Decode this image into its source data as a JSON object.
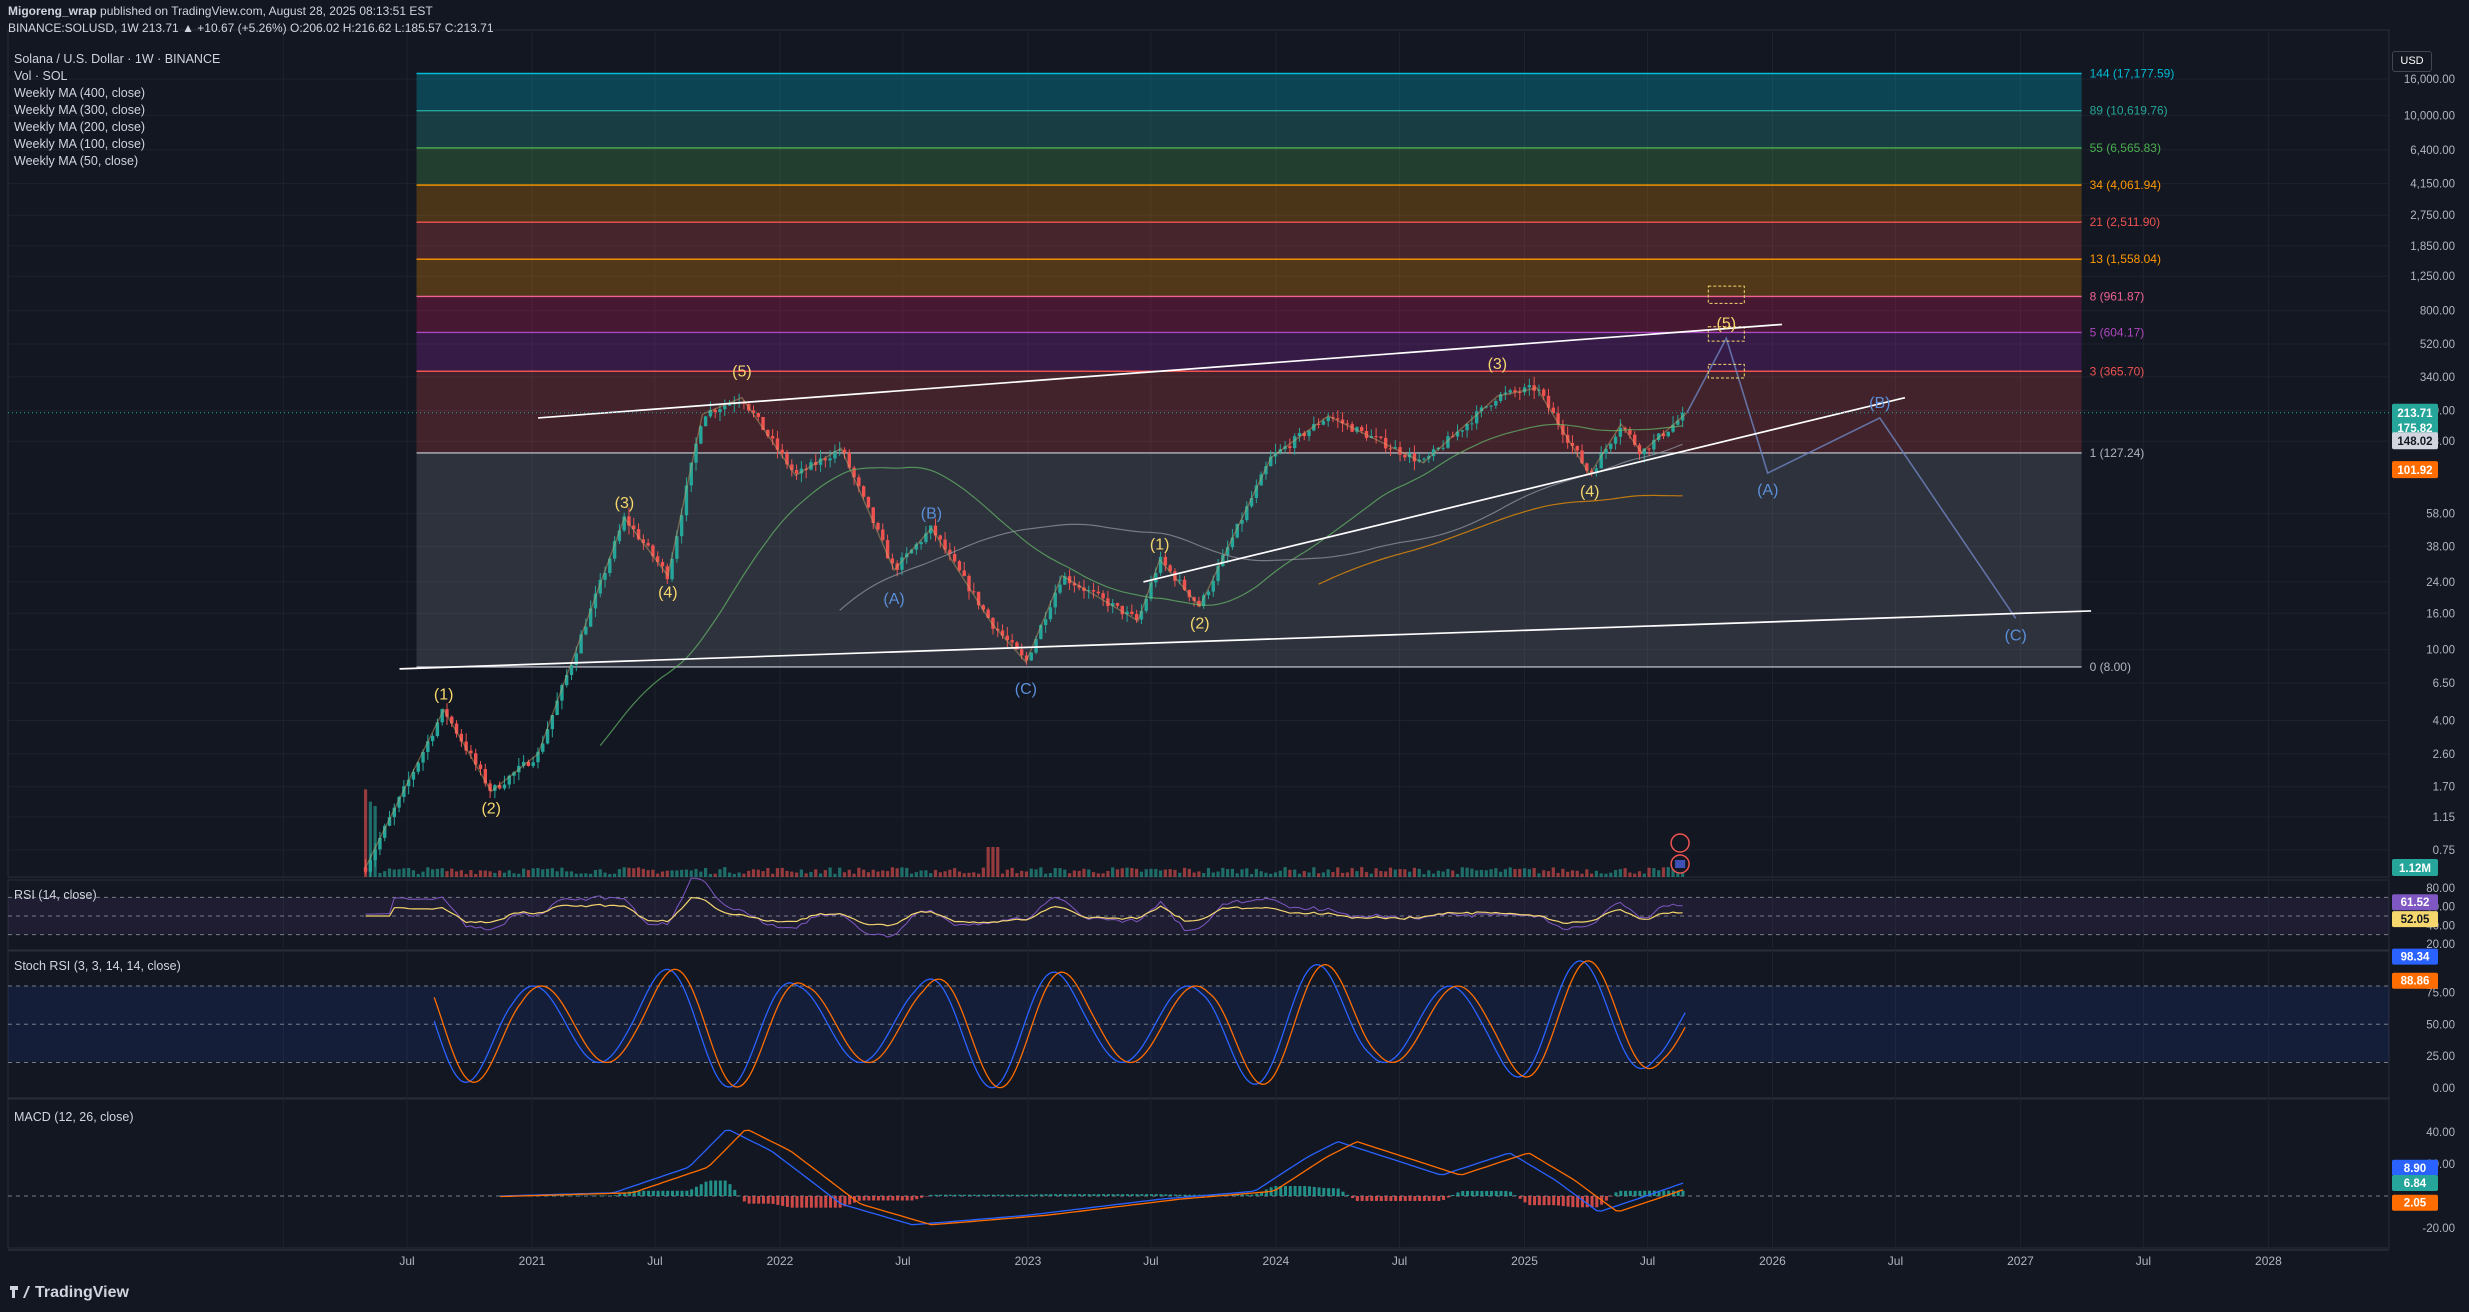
{
  "header": {
    "line1_user": "Migoreng_wrap",
    "line1_rest": " published on TradingView.com, August 28, 2025 08:13:51 EST",
    "line2": "BINANCE:SOLUSD, 1W 213.71 ▲ +10.67 (+5.26%) O:206.02 H:216.62 L:185.57 C:213.71"
  },
  "legend": [
    "Solana / U.S. Dollar · 1W · BINANCE",
    "Vol · SOL",
    "Weekly MA (400, close)",
    "Weekly MA (300, close)",
    "Weekly MA (200, close)",
    "Weekly MA (100, close)",
    "Weekly MA (50, close)"
  ],
  "currency": "USD",
  "brand": "TradingView",
  "pane_labels": {
    "rsi": "RSI (14, close)",
    "stoch": "Stoch RSI (3, 3, 14, 14, close)",
    "macd": "MACD (12, 26, close)"
  },
  "colors": {
    "background": "#131722",
    "up": "#26a69a",
    "down": "#ef5350",
    "wave_yellow": "#f5d76e",
    "wave_blue": "#5b8fd9",
    "rsi_line": "#7e57c2",
    "rsi_ma": "#f5d76e",
    "stoch_k": "#2962ff",
    "stoch_d": "#ff6d00",
    "macd_line": "#2962ff",
    "signal_line": "#ff6d00"
  },
  "chart_data": [
    {
      "type": "candlestick",
      "title": "Solana / U.S. Dollar · 1W · BINANCE",
      "scale": "log",
      "y_ticks": [
        "16,000.00",
        "10,000.00",
        "6,400.00",
        "4,150.00",
        "2,750.00",
        "1,850.00",
        "1,250.00",
        "800.00",
        "520.00",
        "340.00",
        "220.00",
        "148.00",
        "58.00",
        "38.00",
        "24.00",
        "16.00",
        "10.00",
        "6.50",
        "4.00",
        "2.60",
        "1.70",
        "1.15",
        "0.75"
      ],
      "x_ticks": [
        "Jul",
        "2021",
        "Jul",
        "2022",
        "Jul",
        "2023",
        "Jul",
        "2024",
        "Jul",
        "2025",
        "Jul",
        "2026",
        "Jul",
        "2027",
        "Jul",
        "2028"
      ],
      "price_badges": [
        {
          "text": "213.71",
          "color": "#26a69a"
        },
        {
          "text": "175.82",
          "color": "#26a69a"
        },
        {
          "text": "148.02",
          "color": "#d1d4dc"
        },
        {
          "text": "101.92",
          "color": "#ff6d00"
        },
        {
          "text": "1.12M",
          "color": "#26a69a"
        }
      ],
      "price_path": [
        {
          "d": "2020-05-01",
          "p": 0.6
        },
        {
          "d": "2020-08-24",
          "p": 4.6
        },
        {
          "d": "2020-11-02",
          "p": 1.6
        },
        {
          "d": "2021-01-10",
          "p": 2.6
        },
        {
          "d": "2021-05-17",
          "p": 55
        },
        {
          "d": "2021-07-20",
          "p": 26
        },
        {
          "d": "2021-09-09",
          "p": 210
        },
        {
          "d": "2021-11-06",
          "p": 260
        },
        {
          "d": "2022-01-24",
          "p": 95
        },
        {
          "d": "2022-04-01",
          "p": 135
        },
        {
          "d": "2022-06-18",
          "p": 28
        },
        {
          "d": "2022-08-12",
          "p": 48
        },
        {
          "d": "2022-11-09",
          "p": 14
        },
        {
          "d": "2022-12-29",
          "p": 8.5
        },
        {
          "d": "2023-02-20",
          "p": 26
        },
        {
          "d": "2023-06-12",
          "p": 14.5
        },
        {
          "d": "2023-07-14",
          "p": 32
        },
        {
          "d": "2023-09-11",
          "p": 17.5
        },
        {
          "d": "2023-12-25",
          "p": 120
        },
        {
          "d": "2024-03-18",
          "p": 205
        },
        {
          "d": "2024-08-05",
          "p": 112
        },
        {
          "d": "2024-11-22",
          "p": 265
        },
        {
          "d": "2025-01-19",
          "p": 295
        },
        {
          "d": "2025-04-07",
          "p": 96
        },
        {
          "d": "2025-05-23",
          "p": 185
        },
        {
          "d": "2025-06-22",
          "p": 128
        },
        {
          "d": "2025-08-28",
          "p": 213.71
        }
      ],
      "fib_levels": [
        {
          "label": "144 (17,177.59)",
          "value": 17177.59,
          "color": "#00bcd4",
          "fill": "rgba(0,188,212,0.28)"
        },
        {
          "label": "89 (10,619.76)",
          "value": 10619.76,
          "color": "#26a69a",
          "fill": "rgba(38,166,154,0.28)"
        },
        {
          "label": "55 (6,565.83)",
          "value": 6565.83,
          "color": "#4caf50",
          "fill": "rgba(76,175,80,0.26)"
        },
        {
          "label": "34 (4,061.94)",
          "value": 4061.94,
          "color": "#ff9800",
          "fill": "rgba(255,152,0,0.24)"
        },
        {
          "label": "21 (2,511.90)",
          "value": 2511.9,
          "color": "#ef5350",
          "fill": "rgba(239,83,80,0.24)"
        },
        {
          "label": "13 (1,558.04)",
          "value": 1558.04,
          "color": "#ff9800",
          "fill": "rgba(255,152,0,0.26)"
        },
        {
          "label": "8 (961.87)",
          "value": 961.87,
          "color": "#f06292",
          "fill": "rgba(233,30,99,0.24)"
        },
        {
          "label": "5 (604.17)",
          "value": 604.17,
          "color": "#ab47bc",
          "fill": "rgba(156,39,176,0.26)"
        },
        {
          "label": "3 (365.70)",
          "value": 365.7,
          "color": "#ef5350",
          "fill": "rgba(239,83,80,0.22)"
        },
        {
          "label": "1 (127.24)",
          "value": 127.24,
          "color": "#b2b5be",
          "fill": "rgba(178,181,190,0.12)"
        },
        {
          "label": "0 (8.00)",
          "value": 8.0,
          "color": "#b2b5be",
          "fill": null
        }
      ],
      "wave_labels": [
        {
          "t": "(1)",
          "d": "2020-08-24",
          "p": 4.6,
          "c": "yellow",
          "pos": "above"
        },
        {
          "t": "(2)",
          "d": "2020-11-02",
          "p": 1.6,
          "c": "yellow",
          "pos": "below"
        },
        {
          "t": "(3)",
          "d": "2021-05-17",
          "p": 55,
          "c": "yellow",
          "pos": "above"
        },
        {
          "t": "(4)",
          "d": "2021-07-20",
          "p": 26,
          "c": "yellow",
          "pos": "below"
        },
        {
          "t": "(5)",
          "d": "2021-11-06",
          "p": 300,
          "c": "yellow",
          "pos": "above"
        },
        {
          "t": "(A)",
          "d": "2022-06-18",
          "p": 24,
          "c": "blue",
          "pos": "below"
        },
        {
          "t": "(B)",
          "d": "2022-08-12",
          "p": 48,
          "c": "blue",
          "pos": "above"
        },
        {
          "t": "(C)",
          "d": "2022-12-29",
          "p": 7.5,
          "c": "blue",
          "pos": "below"
        },
        {
          "t": "(1)",
          "d": "2023-07-14",
          "p": 32,
          "c": "yellow",
          "pos": "above"
        },
        {
          "t": "(2)",
          "d": "2023-09-11",
          "p": 17.5,
          "c": "yellow",
          "pos": "below"
        },
        {
          "t": "(3)",
          "d": "2024-11-22",
          "p": 330,
          "c": "yellow",
          "pos": "above"
        },
        {
          "t": "(4)",
          "d": "2025-04-07",
          "p": 96,
          "c": "yellow",
          "pos": "below"
        },
        {
          "t": "(5)",
          "d": "2025-10-25",
          "p": 560,
          "c": "yellow",
          "pos": "above"
        },
        {
          "t": "(A)",
          "d": "2025-12-25",
          "p": 98,
          "c": "blue",
          "pos": "below"
        },
        {
          "t": "(B)",
          "d": "2026-06-08",
          "p": 200,
          "c": "blue",
          "pos": "above"
        },
        {
          "t": "(C)",
          "d": "2026-12-25",
          "p": 15,
          "c": "blue",
          "pos": "below"
        }
      ],
      "projection": [
        {
          "d": "2025-08-28",
          "p": 213.71
        },
        {
          "d": "2025-10-25",
          "p": 560
        },
        {
          "d": "2025-12-25",
          "p": 98
        },
        {
          "d": "2026-06-08",
          "p": 200
        },
        {
          "d": "2026-12-25",
          "p": 15
        }
      ],
      "trendlines": [
        {
          "from": {
            "d": "2021-01-10",
            "p": 200
          },
          "to": {
            "d": "2026-01-15",
            "p": 670
          }
        },
        {
          "from": {
            "d": "2023-06-20",
            "p": 24
          },
          "to": {
            "d": "2026-07-15",
            "p": 260
          }
        },
        {
          "from": {
            "d": "2020-06-20",
            "p": 7.8
          },
          "to": {
            "d": "2027-04-15",
            "p": 16.5
          }
        }
      ]
    },
    {
      "type": "line",
      "title": "RSI (14, close)",
      "y_ticks": [
        "80.00",
        "60.00",
        "40.00",
        "20.00"
      ],
      "badges": [
        {
          "text": "61.52",
          "color": "#7e57c2"
        },
        {
          "text": "52.05",
          "color": "#f5d76e"
        }
      ]
    },
    {
      "type": "line",
      "title": "Stoch RSI (3, 3, 14, 14, close)",
      "y_ticks": [
        "75.00",
        "50.00",
        "25.00",
        "0.00"
      ],
      "badges": [
        {
          "text": "98.34",
          "color": "#2962ff"
        },
        {
          "text": "88.86",
          "color": "#ff6d00"
        }
      ]
    },
    {
      "type": "bar",
      "title": "MACD (12, 26, close)",
      "y_ticks": [
        "40.00",
        "20.00",
        "-20.00"
      ],
      "badges": [
        {
          "text": "8.90",
          "color": "#2962ff"
        },
        {
          "text": "6.84",
          "color": "#26a69a"
        },
        {
          "text": "2.05",
          "color": "#ff6d00"
        }
      ]
    }
  ]
}
